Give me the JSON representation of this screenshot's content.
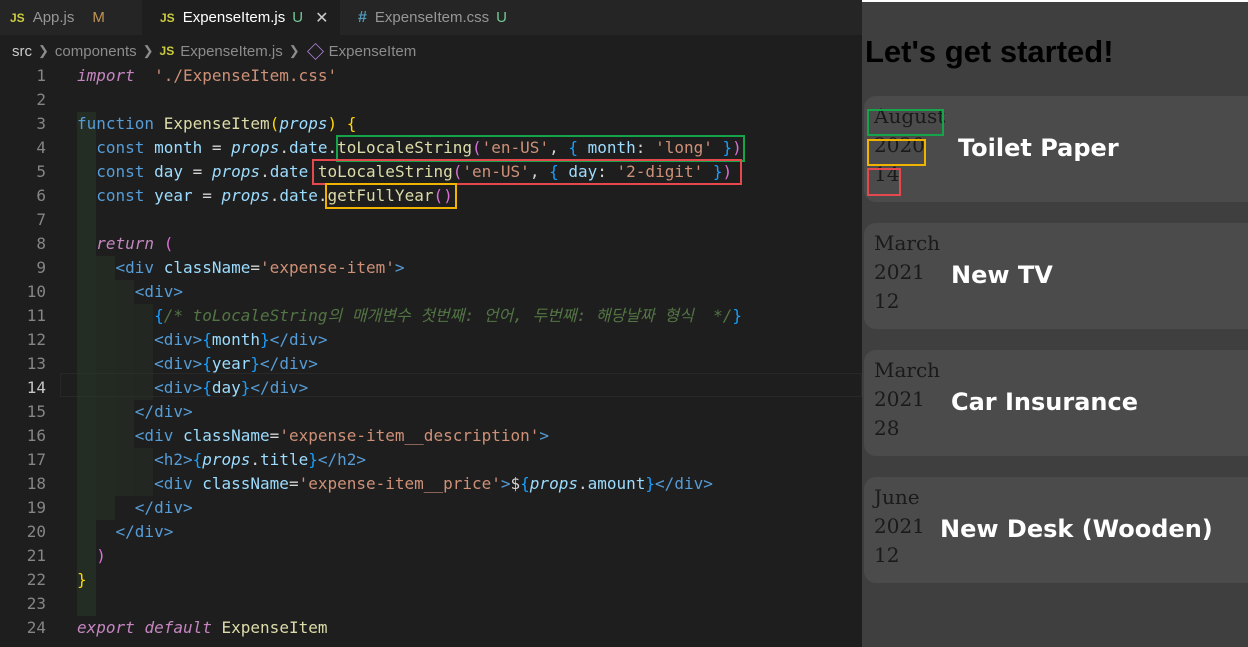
{
  "tabs": [
    {
      "badge": "JS",
      "name": "App.js",
      "status": "M"
    },
    {
      "badge": "JS",
      "name": "ExpenseItem.js",
      "status": "U",
      "close": "✕"
    },
    {
      "badge": "#",
      "name": "ExpenseItem.css",
      "status": "U"
    }
  ],
  "breadcrumb": {
    "root": "src",
    "folder": "components",
    "file": "ExpenseItem.js",
    "symbol": "ExpenseItem",
    "file_badge": "JS"
  },
  "current_line": 14,
  "code_lines": [
    {
      "n": "1",
      "tokens": [
        [
          "ctl",
          "import"
        ],
        [
          "",
          "  "
        ],
        [
          "str",
          "'./ExpenseItem.css'"
        ]
      ]
    },
    {
      "n": "2",
      "tokens": []
    },
    {
      "n": "3",
      "tokens": [
        [
          "kw",
          "function"
        ],
        [
          "",
          " "
        ],
        [
          "fn",
          "ExpenseItem"
        ],
        [
          "br1",
          "("
        ],
        [
          "prm",
          "props"
        ],
        [
          "br1",
          ")"
        ],
        [
          "",
          " "
        ],
        [
          "br1",
          "{"
        ]
      ]
    },
    {
      "n": "4",
      "tokens": [
        [
          "",
          "  "
        ],
        [
          "kw",
          "const"
        ],
        [
          "",
          " "
        ],
        [
          "var",
          "month"
        ],
        [
          "",
          " = "
        ],
        [
          "prm",
          "props"
        ],
        [
          "",
          "."
        ],
        [
          "var",
          "date"
        ],
        [
          "",
          "."
        ],
        [
          "fn",
          "toLocaleString"
        ],
        [
          "br2",
          "("
        ],
        [
          "str",
          "'en-US'"
        ],
        [
          ", "
        ],
        [
          "br3",
          "{"
        ],
        [
          "",
          " "
        ],
        [
          "var",
          "month"
        ],
        [
          ": "
        ],
        [
          "str",
          "'long'"
        ],
        [
          "",
          " "
        ],
        [
          "br3",
          "}"
        ],
        [
          "br2",
          ")"
        ]
      ]
    },
    {
      "n": "5",
      "tokens": [
        [
          "",
          "  "
        ],
        [
          "kw",
          "const"
        ],
        [
          "",
          " "
        ],
        [
          "var",
          "day"
        ],
        [
          "",
          " = "
        ],
        [
          "prm",
          "props"
        ],
        [
          "",
          "."
        ],
        [
          "var",
          "date"
        ],
        [
          "",
          "."
        ],
        [
          "fn",
          "toLocaleString"
        ],
        [
          "br2",
          "("
        ],
        [
          "str",
          "'en-US'"
        ],
        [
          ", "
        ],
        [
          "br3",
          "{"
        ],
        [
          "",
          " "
        ],
        [
          "var",
          "day"
        ],
        [
          ": "
        ],
        [
          "str",
          "'2-digit'"
        ],
        [
          "",
          " "
        ],
        [
          "br3",
          "}"
        ],
        [
          "br2",
          ")"
        ]
      ]
    },
    {
      "n": "6",
      "tokens": [
        [
          "",
          "  "
        ],
        [
          "kw",
          "const"
        ],
        [
          "",
          " "
        ],
        [
          "var",
          "year"
        ],
        [
          "",
          " = "
        ],
        [
          "prm",
          "props"
        ],
        [
          "",
          "."
        ],
        [
          "var",
          "date"
        ],
        [
          "",
          "."
        ],
        [
          "fn",
          "getFullYear"
        ],
        [
          "br2",
          "()"
        ]
      ]
    },
    {
      "n": "7",
      "tokens": []
    },
    {
      "n": "8",
      "tokens": [
        [
          "",
          "  "
        ],
        [
          "ctl",
          "return"
        ],
        [
          "",
          " "
        ],
        [
          "br2",
          "("
        ]
      ]
    },
    {
      "n": "9",
      "tokens": [
        [
          "",
          "    "
        ],
        [
          "tag",
          "<div"
        ],
        [
          "",
          " "
        ],
        [
          "attr",
          "className"
        ],
        [
          "",
          "="
        ],
        [
          "str",
          "'expense-item'"
        ],
        [
          "tag",
          ">"
        ]
      ]
    },
    {
      "n": "10",
      "tokens": [
        [
          "",
          "      "
        ],
        [
          "tag",
          "<div>"
        ]
      ]
    },
    {
      "n": "11",
      "tokens": [
        [
          "",
          "        "
        ],
        [
          "br3",
          "{"
        ],
        [
          "cmt",
          "/* toLocaleString의 매개변수 첫번째: 언어, 두번째: 해당날짜 형식  */"
        ],
        [
          "br3",
          "}"
        ]
      ]
    },
    {
      "n": "12",
      "tokens": [
        [
          "",
          "        "
        ],
        [
          "tag",
          "<div>"
        ],
        [
          "br3",
          "{"
        ],
        [
          "var",
          "month"
        ],
        [
          "br3",
          "}"
        ],
        [
          "tag",
          "</div>"
        ]
      ]
    },
    {
      "n": "13",
      "tokens": [
        [
          "",
          "        "
        ],
        [
          "tag",
          "<div>"
        ],
        [
          "br3",
          "{"
        ],
        [
          "var",
          "year"
        ],
        [
          "br3",
          "}"
        ],
        [
          "tag",
          "</div>"
        ]
      ]
    },
    {
      "n": "14",
      "tokens": [
        [
          "",
          "        "
        ],
        [
          "tag",
          "<div>"
        ],
        [
          "br3",
          "{"
        ],
        [
          "var",
          "day"
        ],
        [
          "br3",
          "}"
        ],
        [
          "tag",
          "</div>"
        ]
      ]
    },
    {
      "n": "15",
      "tokens": [
        [
          "",
          "      "
        ],
        [
          "tag",
          "</div>"
        ]
      ]
    },
    {
      "n": "16",
      "tokens": [
        [
          "",
          "      "
        ],
        [
          "tag",
          "<div"
        ],
        [
          "",
          " "
        ],
        [
          "attr",
          "className"
        ],
        [
          "",
          "="
        ],
        [
          "str",
          "'expense-item__description'"
        ],
        [
          "tag",
          ">"
        ]
      ]
    },
    {
      "n": "17",
      "tokens": [
        [
          "",
          "        "
        ],
        [
          "tag",
          "<h2>"
        ],
        [
          "br3",
          "{"
        ],
        [
          "prm",
          "props"
        ],
        [
          "",
          "."
        ],
        [
          "var",
          "title"
        ],
        [
          "br3",
          "}"
        ],
        [
          "tag",
          "</h2>"
        ]
      ]
    },
    {
      "n": "18",
      "tokens": [
        [
          "",
          "        "
        ],
        [
          "tag",
          "<div"
        ],
        [
          "",
          " "
        ],
        [
          "attr",
          "className"
        ],
        [
          "",
          "="
        ],
        [
          "str",
          "'expense-item__price'"
        ],
        [
          "tag",
          ">"
        ],
        [
          "",
          "$"
        ],
        [
          "br3",
          "{"
        ],
        [
          "prm",
          "props"
        ],
        [
          "",
          "."
        ],
        [
          "var",
          "amount"
        ],
        [
          "br3",
          "}"
        ],
        [
          "tag",
          "</div>"
        ]
      ]
    },
    {
      "n": "19",
      "tokens": [
        [
          "",
          "      "
        ],
        [
          "tag",
          "</div>"
        ]
      ]
    },
    {
      "n": "20",
      "tokens": [
        [
          "",
          "    "
        ],
        [
          "tag",
          "</div>"
        ]
      ]
    },
    {
      "n": "21",
      "tokens": [
        [
          "",
          "  "
        ],
        [
          "br2",
          ")"
        ]
      ]
    },
    {
      "n": "22",
      "tokens": [
        [
          "br1",
          "}"
        ]
      ]
    },
    {
      "n": "23",
      "tokens": []
    },
    {
      "n": "24",
      "tokens": [
        [
          "ctl",
          "export"
        ],
        [
          "",
          " "
        ],
        [
          "ctl",
          "default"
        ],
        [
          "",
          " "
        ],
        [
          "fn",
          "ExpenseItem"
        ]
      ]
    }
  ],
  "highlight_colors": {
    "green": "#16a44a",
    "red": "#e5484d",
    "yellow": "#f0b400"
  },
  "preview": {
    "heading": "Let's get started!",
    "items": [
      {
        "month": "August",
        "year": "2020",
        "day": "14",
        "title": "Toilet Paper"
      },
      {
        "month": "March",
        "year": "2021",
        "day": "12",
        "title": "New TV"
      },
      {
        "month": "March",
        "year": "2021",
        "day": "28",
        "title": "Car Insurance"
      },
      {
        "month": "June",
        "year": "2021",
        "day": "12",
        "title": "New Desk (Wooden)"
      }
    ]
  }
}
